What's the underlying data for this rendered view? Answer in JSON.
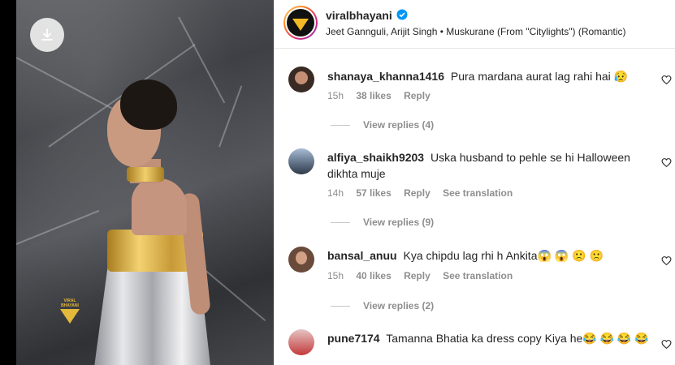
{
  "post": {
    "username": "viralbhayani",
    "audio": "Jeet Gannguli, Arijit Singh • Muskurane (From \"Citylights\") (Romantic)"
  },
  "media": {
    "download_icon": "download-icon",
    "watermark_text": "VIRAL BHAYANI"
  },
  "comments": [
    {
      "username": "shanaya_khanna1416",
      "text": "Pura mardana aurat lag rahi hai 😥",
      "time": "15h",
      "likes": "38 likes",
      "reply": "Reply",
      "translation": "",
      "view_replies": "View replies (4)",
      "avatar_color": "#3a2a24"
    },
    {
      "username": "alfiya_shaikh9203",
      "text": "Uska husband to pehle se hi Halloween dikhta muje",
      "time": "14h",
      "likes": "57 likes",
      "reply": "Reply",
      "translation": "See translation",
      "view_replies": "View replies (9)",
      "avatar_color": "#5b6c82"
    },
    {
      "username": "bansal_anuu",
      "text": "Kya chipdu lag rhi h Ankita😱 😱 🙁 🙁",
      "time": "15h",
      "likes": "40 likes",
      "reply": "Reply",
      "translation": "See translation",
      "view_replies": "View replies (2)",
      "avatar_color": "#6a4a3a"
    },
    {
      "username": "pune7174",
      "text": "Tamanna Bhatia ka dress copy Kiya he😂 😂 😂 😂",
      "time": "",
      "likes": "",
      "reply": "",
      "translation": "",
      "view_replies": "",
      "avatar_color": "#c33a3a"
    }
  ],
  "colors": {
    "text": "#262626",
    "muted": "#8e8e8e",
    "verified": "#0095f6",
    "brand_gold": "#f2b825"
  }
}
